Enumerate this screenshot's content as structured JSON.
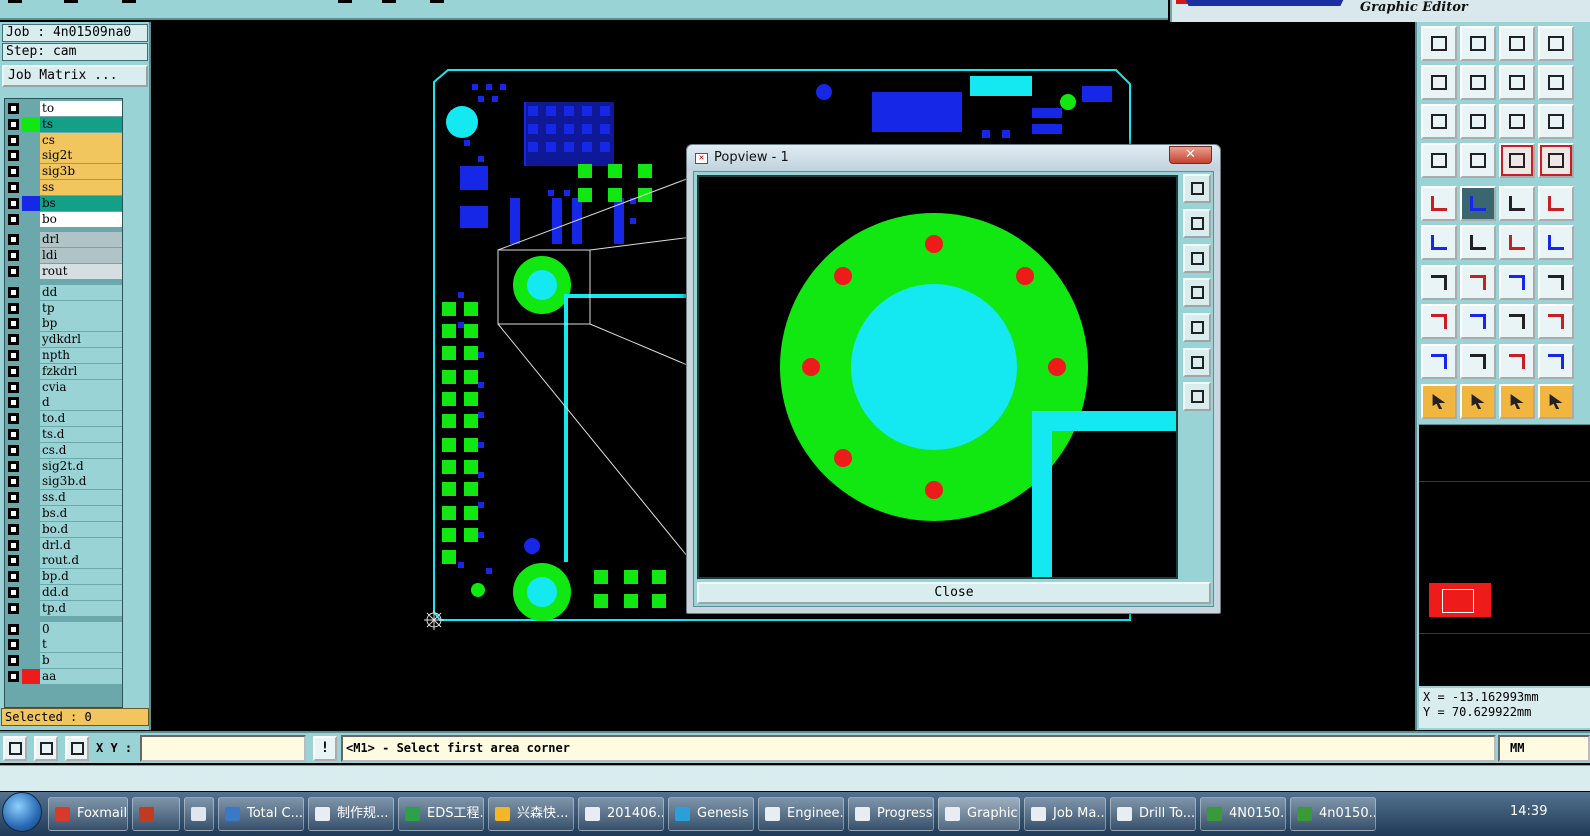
{
  "brand": {
    "subtitle": "Graphic Editor"
  },
  "left": {
    "job": "Job : 4n01509na0",
    "step": "Step: cam",
    "matrix_button": "Job Matrix ...",
    "selected": "Selected : 0",
    "layers": [
      {
        "name": "to",
        "color": "#ffffff",
        "swatch": ""
      },
      {
        "name": "ts",
        "color": "#14a088",
        "swatch": "#11e811"
      },
      {
        "name": "cs",
        "color": "#f2c65e",
        "swatch": ""
      },
      {
        "name": "sig2t",
        "color": "#f2c65e",
        "swatch": ""
      },
      {
        "name": "sig3b",
        "color": "#f2c65e",
        "swatch": ""
      },
      {
        "name": "ss",
        "color": "#f2c65e",
        "swatch": ""
      },
      {
        "name": "bs",
        "color": "#14a088",
        "swatch": "#1727e8"
      },
      {
        "name": "bo",
        "color": "#ffffff",
        "swatch": ""
      },
      {
        "name": "drl",
        "color": "#b0c4c8",
        "swatch": ""
      },
      {
        "name": "ldi",
        "color": "#b0c4c8",
        "swatch": ""
      },
      {
        "name": "rout",
        "color": "#d5dfe2",
        "swatch": ""
      },
      {
        "name": "dd",
        "color": "#9ad3d6",
        "swatch": ""
      },
      {
        "name": "tp",
        "color": "#9ad3d6",
        "swatch": ""
      },
      {
        "name": "bp",
        "color": "#9ad3d6",
        "swatch": ""
      },
      {
        "name": "ydkdrl",
        "color": "#9ad3d6",
        "swatch": ""
      },
      {
        "name": "npth",
        "color": "#9ad3d6",
        "swatch": ""
      },
      {
        "name": "fzkdrl",
        "color": "#9ad3d6",
        "swatch": ""
      },
      {
        "name": "cvia",
        "color": "#9ad3d6",
        "swatch": ""
      },
      {
        "name": "d",
        "color": "#9ad3d6",
        "swatch": ""
      },
      {
        "name": "to.d",
        "color": "#9ad3d6",
        "swatch": ""
      },
      {
        "name": "ts.d",
        "color": "#9ad3d6",
        "swatch": ""
      },
      {
        "name": "cs.d",
        "color": "#9ad3d6",
        "swatch": ""
      },
      {
        "name": "sig2t.d",
        "color": "#9ad3d6",
        "swatch": ""
      },
      {
        "name": "sig3b.d",
        "color": "#9ad3d6",
        "swatch": ""
      },
      {
        "name": "ss.d",
        "color": "#9ad3d6",
        "swatch": ""
      },
      {
        "name": "bs.d",
        "color": "#9ad3d6",
        "swatch": ""
      },
      {
        "name": "bo.d",
        "color": "#9ad3d6",
        "swatch": ""
      },
      {
        "name": "drl.d",
        "color": "#9ad3d6",
        "swatch": ""
      },
      {
        "name": "rout.d",
        "color": "#9ad3d6",
        "swatch": ""
      },
      {
        "name": "bp.d",
        "color": "#9ad3d6",
        "swatch": ""
      },
      {
        "name": "dd.d",
        "color": "#9ad3d6",
        "swatch": ""
      },
      {
        "name": "tp.d",
        "color": "#9ad3d6",
        "swatch": ""
      },
      {
        "name": "0",
        "color": "#9ad3d6",
        "swatch": ""
      },
      {
        "name": "t",
        "color": "#9ad3d6",
        "swatch": ""
      },
      {
        "name": "b",
        "color": "#9ad3d6",
        "swatch": ""
      },
      {
        "name": "aa",
        "color": "#9ad3d6",
        "swatch": "#ee1b1b"
      }
    ]
  },
  "popview": {
    "title": "Popview - 1",
    "close_x": "✕",
    "close_button": "Close"
  },
  "right": {
    "coord_x": "X = -13.162993mm",
    "coord_y": "Y = 70.629922mm"
  },
  "cmd": {
    "xy_label": "X Y :",
    "xy_value": "",
    "excl": "!",
    "message": "<M1> - Select first area corner",
    "unit": "MM"
  },
  "taskbar": {
    "items": [
      {
        "label": "Foxmail",
        "color": "#d83a2a"
      },
      {
        "label": "",
        "color": "#c23a22"
      },
      {
        "label": "",
        "color": "#dfe6ee"
      },
      {
        "label": "Total C...",
        "color": "#3a78c8"
      },
      {
        "label": "制作规...",
        "color": "#e8edf3"
      },
      {
        "label": "EDS工程...",
        "color": "#2da04a"
      },
      {
        "label": "兴森快...",
        "color": "#f2b627"
      },
      {
        "label": "201406...",
        "color": "#e8edf3"
      },
      {
        "label": "Genesis",
        "color": "#2aa0d8"
      },
      {
        "label": "Enginee...",
        "color": "#e8edf3"
      },
      {
        "label": "Progress",
        "color": "#e8edf3"
      },
      {
        "label": "Graphic...",
        "color": "#e8edf3"
      },
      {
        "label": "Job Ma...",
        "color": "#e8edf3"
      },
      {
        "label": "Drill To...",
        "color": "#e8edf3"
      },
      {
        "label": "4N0150...",
        "color": "#3a9a3a"
      },
      {
        "label": "4n0150...",
        "color": "#3a9a3a"
      }
    ],
    "clock": "14:39"
  }
}
